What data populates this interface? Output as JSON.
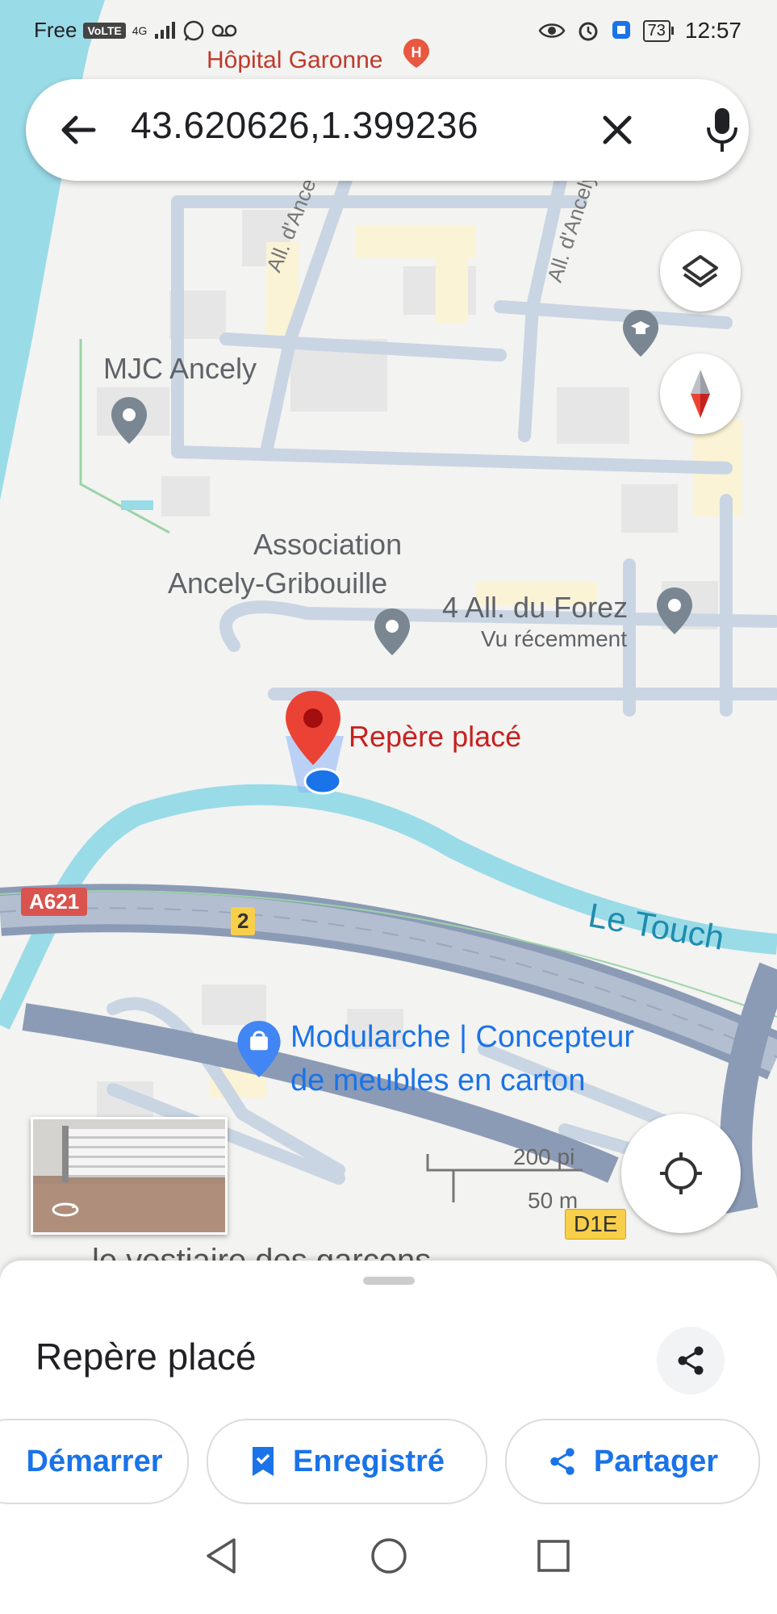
{
  "status_bar": {
    "carrier": "Free",
    "volte": "VoLTE",
    "network": "4G",
    "battery": "73",
    "time": "12:57"
  },
  "search": {
    "query": "43.620626,1.399236"
  },
  "map": {
    "labels": {
      "hospital": "Hôpital Garonne",
      "mjc": "MJC Ancely",
      "association_line1": "Association",
      "association_line2": "Ancely-Gribouille",
      "forez": "4 All. du Forez",
      "forez_sub": "Vu récemment",
      "pin": "Repère placé",
      "river": "Le Touch",
      "modularche_line1": "Modularche | Concepteur",
      "modularche_line2": "de meubles en carton",
      "cut_text": "le vestiaire des garçons"
    },
    "roads": {
      "ancely1": "All. d'Ancely",
      "ancely2": "All. d'Ancely",
      "a621": "A621",
      "exit": "2",
      "d1e": "D1E"
    },
    "scale": {
      "feet": "200 pi",
      "meters": "50 m"
    },
    "colors": {
      "water": "#9adbe8",
      "road": "#c9d5e3",
      "highway": "#8c9bb5",
      "pin": "#ea4335",
      "accent": "#1a73e8"
    }
  },
  "sheet": {
    "title": "Repère placé",
    "chips": [
      {
        "label": "Démarrer",
        "icon": "directions-icon"
      },
      {
        "label": "Enregistré",
        "icon": "bookmark-icon"
      },
      {
        "label": "Partager",
        "icon": "share-icon"
      }
    ]
  }
}
